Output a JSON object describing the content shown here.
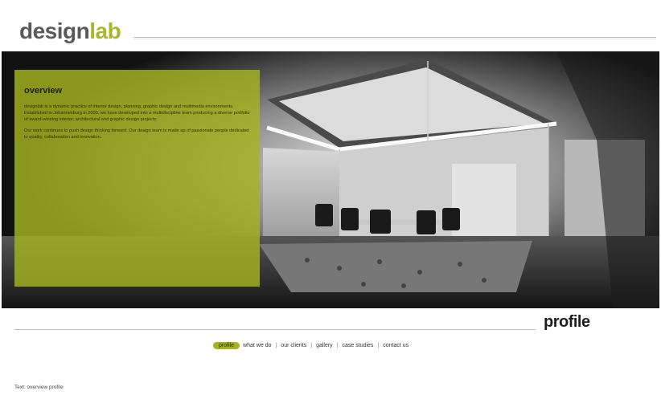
{
  "header": {
    "logo_part1": "design",
    "logo_part2": "lab",
    "logo_colors": {
      "part1": "#5a5a5a",
      "part2": "#a9b82a"
    }
  },
  "hero": {
    "image_description_icon": "conference-room-photo",
    "overlay": {
      "title": "overview",
      "paragraph1": "designlab is a dynamic practice of interior design, planning, graphic design and multimedia environments. Established in Johannesburg in 2000, we have developed into a multidiscipline team producing a diverse portfolio of award-winning interior, architectural and graphic design projects.",
      "paragraph2": "Our work continues to push design thinking forward. Our design team is made up of passionate people dedicated to quality, collaboration and innovation."
    },
    "accent_color": "#a4b41e"
  },
  "section": {
    "title": "profile"
  },
  "nav": {
    "items": [
      {
        "label": "profile",
        "active": true
      },
      {
        "label": "what we do",
        "active": false
      },
      {
        "label": "our clients",
        "active": false
      },
      {
        "label": "gallery",
        "active": false
      },
      {
        "label": "case studies",
        "active": false
      },
      {
        "label": "contact us",
        "active": false
      }
    ],
    "separator": "|"
  },
  "footer": {
    "text": "Text: overview profile"
  }
}
